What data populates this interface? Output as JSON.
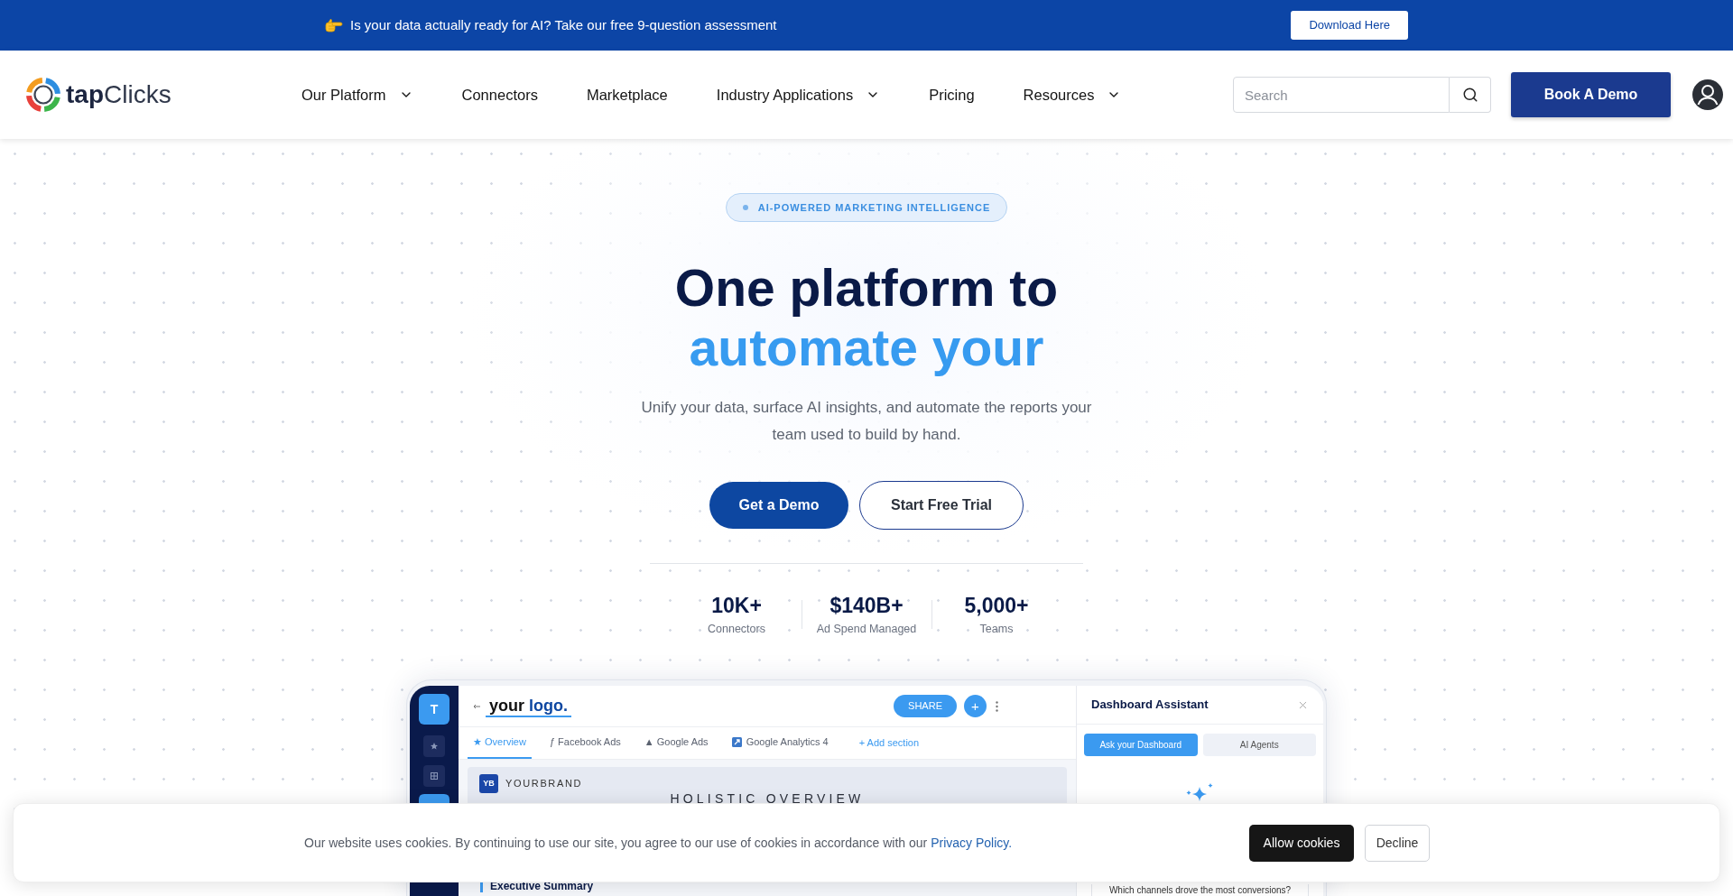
{
  "announcement_bar": {
    "text": "Is your data actually ready for AI? Take our free 9-question assessment",
    "button": "Download Here"
  },
  "header": {
    "logo": {
      "bold": "tap",
      "light": "Clicks"
    },
    "nav_items": [
      {
        "label": "Our Platform",
        "has_menu": true
      },
      {
        "label": "Connectors",
        "has_menu": false
      },
      {
        "label": "Marketplace",
        "has_menu": false
      },
      {
        "label": "Industry Applications",
        "has_menu": true
      },
      {
        "label": "Pricing",
        "has_menu": false
      },
      {
        "label": "Resources",
        "has_menu": true
      }
    ],
    "search": {
      "placeholder": "Search"
    },
    "cta": "Book A Demo"
  },
  "hero": {
    "badge": "AI-POWERED MARKETING INTELLIGENCE",
    "title_lines": [
      {
        "text": "One platform to",
        "accent": false
      },
      {
        "text": "automate your",
        "accent": true
      }
    ],
    "subtitle": "Unify your data, surface AI insights, and automate the reports your team used to build by hand.",
    "buttons": [
      {
        "label": "Get a Demo",
        "kind": "primary"
      },
      {
        "label": "Start Free Trial",
        "kind": "outline"
      }
    ],
    "stats": [
      {
        "value": "10K+",
        "label": "Connectors"
      },
      {
        "value": "$140B+",
        "label": "Ad Spend Managed"
      },
      {
        "value": "5,000+",
        "label": "Teams"
      }
    ]
  },
  "dashboard_preview": {
    "sidebar": {
      "workspace_letter": "T"
    },
    "header": {
      "logo_dark": "your",
      "logo_accent": "logo.",
      "share_button": "SHARE",
      "add_button": "+"
    },
    "tabs": [
      {
        "label": "★ Overview",
        "selected": true,
        "kind": "glyph"
      },
      {
        "label": "ƒ Facebook Ads",
        "selected": false,
        "kind": "glyph"
      },
      {
        "label": "▲ Google Ads",
        "selected": false,
        "kind": "glyph"
      },
      {
        "label": "Google Analytics 4",
        "selected": false,
        "kind": "badge"
      }
    ],
    "add_section": "+ Add section",
    "brand": {
      "initials": "YB",
      "name": "YOURBRAND"
    },
    "section_title": "HOLISTIC OVERVIEW",
    "summary_heading": "Executive Summary",
    "assistant": {
      "title": "Dashboard Assistant",
      "tabs": [
        {
          "label": "Ask your Dashboard",
          "selected": true
        },
        {
          "label": "AI Agents",
          "selected": false
        }
      ],
      "question": "Which channels drove the most conversions?"
    }
  },
  "cookie_banner": {
    "text": "Our website uses cookies. By continuing to use our site, you agree to our use of cookies in accordance with our",
    "link": "Privacy Policy.",
    "buttons": [
      {
        "label": "Allow cookies",
        "kind": "primary"
      },
      {
        "label": "Decline",
        "kind": "secondary"
      }
    ]
  }
}
